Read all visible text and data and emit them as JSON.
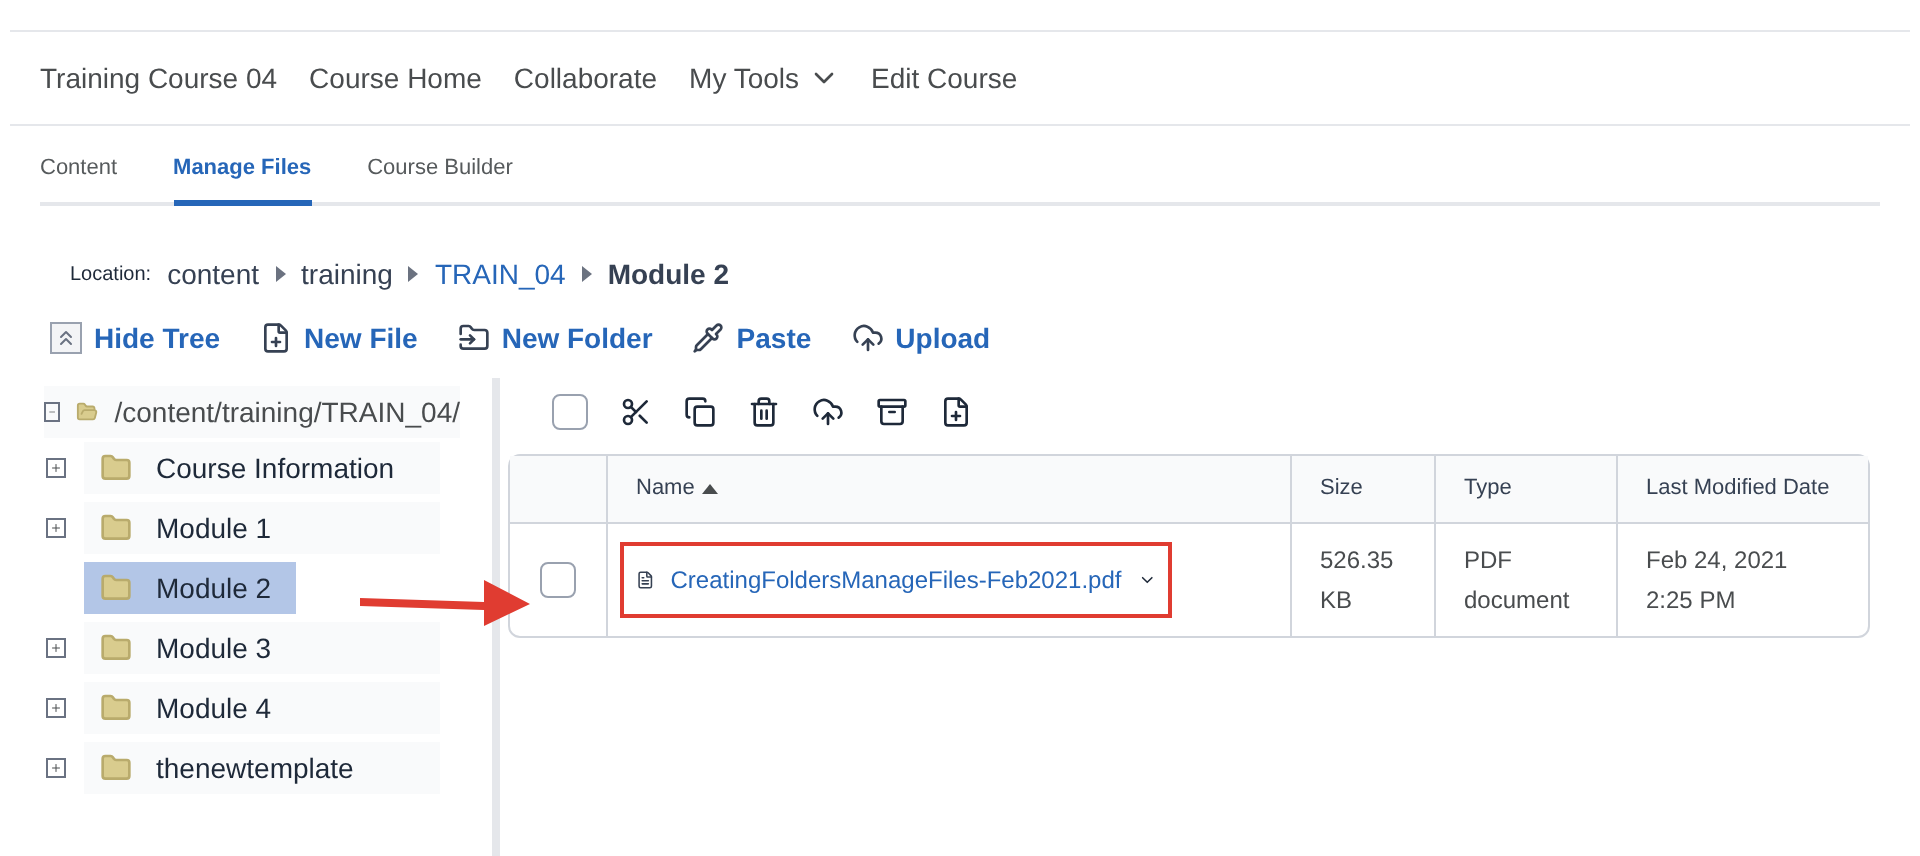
{
  "nav": [
    {
      "label": "Training Course 04",
      "dropdown": false
    },
    {
      "label": "Course Home",
      "dropdown": false
    },
    {
      "label": "Collaborate",
      "dropdown": false
    },
    {
      "label": "My Tools",
      "dropdown": true
    },
    {
      "label": "Edit Course",
      "dropdown": false
    }
  ],
  "tabs": [
    {
      "label": "Content",
      "selected": false
    },
    {
      "label": "Manage Files",
      "selected": true
    },
    {
      "label": "Course Builder",
      "selected": false
    }
  ],
  "location": {
    "label": "Location:",
    "crumbs": [
      {
        "label": "content",
        "kind": "plain"
      },
      {
        "label": "training",
        "kind": "plain"
      },
      {
        "label": "TRAIN_04",
        "kind": "link"
      },
      {
        "label": "Module 2",
        "kind": "current"
      }
    ]
  },
  "actions": [
    {
      "label": "Hide Tree"
    },
    {
      "label": "New File"
    },
    {
      "label": "New Folder"
    },
    {
      "label": "Paste"
    },
    {
      "label": "Upload"
    }
  ],
  "select_all": {
    "checked": false
  },
  "tree": {
    "label": "/content/training/TRAIN_04/",
    "expanded": true,
    "children": [
      {
        "label": "Course Information",
        "expandable": true,
        "selected": false
      },
      {
        "label": "Module 1",
        "expandable": true,
        "selected": false
      },
      {
        "label": "Module 2",
        "expandable": false,
        "selected": true
      },
      {
        "label": "Module 3",
        "expandable": true,
        "selected": false
      },
      {
        "label": "Module 4",
        "expandable": true,
        "selected": false
      },
      {
        "label": "thenewtemplate",
        "expandable": true,
        "selected": false
      }
    ]
  },
  "table": {
    "columns": [
      "Name",
      "Size",
      "Type",
      "Last Modified Date"
    ],
    "rows": [
      {
        "name": "CreatingFoldersManageFiles-Feb2021.pdf",
        "size": [
          "526.35",
          "KB"
        ],
        "type": [
          "PDF",
          "document"
        ],
        "date": [
          "Feb 24, 2021",
          "2:25 PM"
        ],
        "checked": false,
        "highlighted": true
      }
    ]
  }
}
